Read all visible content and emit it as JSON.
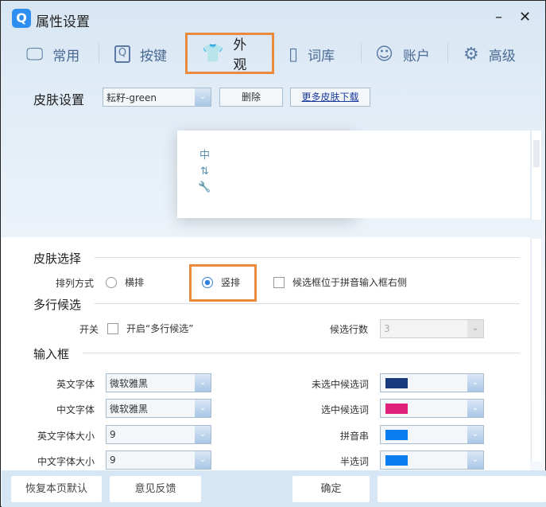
{
  "window": {
    "title": "属性设置",
    "minimize": "–",
    "close": "✕"
  },
  "tabs": [
    {
      "label": "常用",
      "icon": "monitor-icon",
      "glyph": "🖵"
    },
    {
      "label": "按键",
      "icon": "key-icon",
      "glyph": "Q"
    },
    {
      "label": "外观",
      "icon": "tshirt-icon",
      "glyph": "👕",
      "active": true
    },
    {
      "label": "词库",
      "icon": "book-icon",
      "glyph": "▯"
    },
    {
      "label": "账户",
      "icon": "user-icon",
      "glyph": "☺"
    },
    {
      "label": "高级",
      "icon": "gear-icon",
      "glyph": "⚙"
    }
  ],
  "skin": {
    "label": "皮肤设置",
    "value": "耘籽-green",
    "delete": "删除",
    "more": "更多皮肤下载"
  },
  "preview": {
    "icons": [
      "中",
      "⇅",
      "🔧"
    ]
  },
  "skin_select": {
    "title": "皮肤选择",
    "arrange_label": "排列方式",
    "horizontal": "横排",
    "vertical": "竖排",
    "selected": "竖排",
    "right_side": "候选框位于拼音输入框右侧",
    "right_side_checked": false
  },
  "multi": {
    "title": "多行候选",
    "switch_label": "开关",
    "enable": "开启“多行候选”",
    "enabled": false,
    "rows_label": "候选行数",
    "rows_value": "3"
  },
  "input_box": {
    "title": "输入框",
    "left": [
      {
        "label": "英文字体",
        "value": "微软雅黑"
      },
      {
        "label": "中文字体",
        "value": "微软雅黑"
      },
      {
        "label": "英文字体大小",
        "value": "9"
      },
      {
        "label": "中文字体大小",
        "value": "9"
      }
    ],
    "right": [
      {
        "label": "未选中候选词",
        "color": "#1a3a80"
      },
      {
        "label": "选中候选词",
        "color": "#e0207a"
      },
      {
        "label": "拼音串",
        "color": "#0a7ef0"
      },
      {
        "label": "半选词",
        "color": "#0a7ef0"
      }
    ]
  },
  "footer": {
    "restore": "恢复本页默认",
    "feedback": "意见反馈",
    "ok": "确定"
  }
}
